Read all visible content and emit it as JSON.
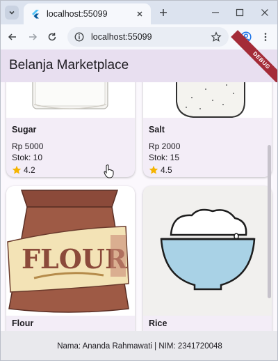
{
  "browser": {
    "tab_title": "localhost:55099",
    "url": "localhost:55099"
  },
  "app": {
    "title": "Belanja Marketplace",
    "debug_label": "DEBUG"
  },
  "products": [
    {
      "name": "Sugar",
      "price": "Rp 5000",
      "stock": "Stok: 10",
      "rating": "4.2"
    },
    {
      "name": "Salt",
      "price": "Rp 2000",
      "stock": "Stok: 15",
      "rating": "4.5"
    },
    {
      "name": "Flour"
    },
    {
      "name": "Rice"
    }
  ],
  "footer": {
    "text": "Nama: Ananda Rahmawati | NIM: 2341720048"
  },
  "colors": {
    "appbar": "#e8dff0",
    "card": "#f3edf7",
    "star": "#f5b400",
    "debug": "#a42c38"
  },
  "icons": {
    "flour_bag_label": "FLOUR"
  }
}
